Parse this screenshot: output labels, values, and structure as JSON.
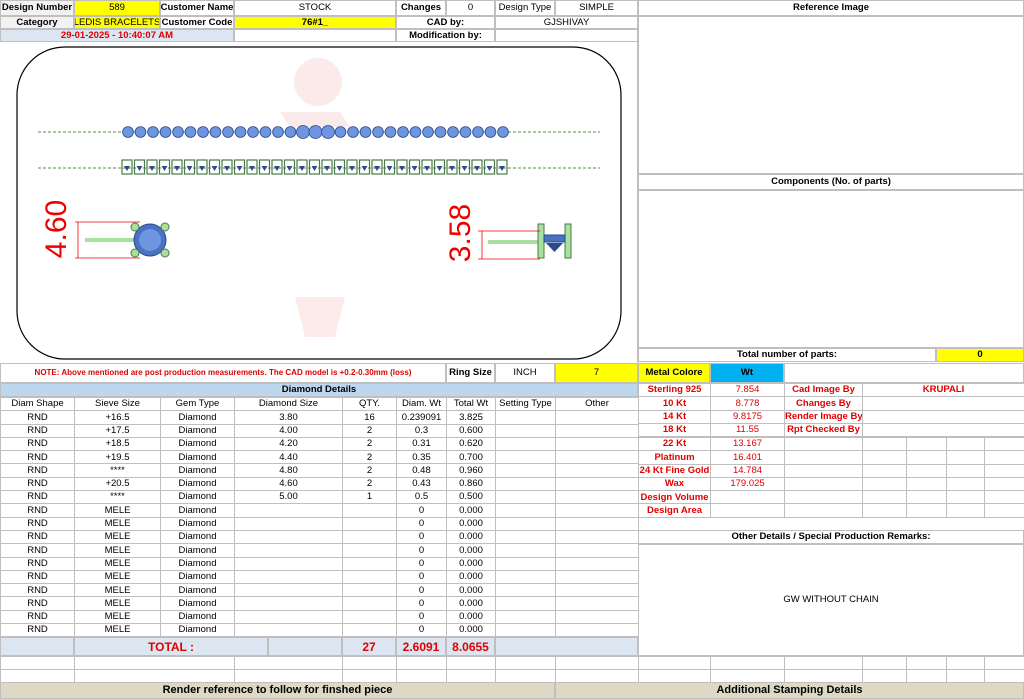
{
  "header": {
    "design_number_label": "Design Number",
    "design_number": "589",
    "customer_name_label": "Customer Name",
    "customer_name": "STOCK",
    "changes_label": "Changes",
    "changes": "0",
    "design_type_label": "Design Type",
    "design_type": "SIMPLE",
    "category_label": "Category",
    "category": "LEDIS BRACELETS",
    "customer_code_label": "Customer Code",
    "customer_code": "76#1_",
    "cad_by_label": "CAD by:",
    "cad_by": "GJSHIVAY",
    "datetime": "29-01-2025 - 10:40:07 AM",
    "modification_label": "Modification by:"
  },
  "drawing": {
    "dim_left": "4.60",
    "dim_right": "3.58"
  },
  "reference": {
    "reference_image_label": "Reference Image",
    "components_label": "Components (No. of parts)",
    "total_parts_label": "Total number of parts:",
    "total_parts": "0"
  },
  "note": {
    "text": "NOTE: Above mentioned are post production measurements. The CAD model is +0.2-0.30mm (loss)",
    "ring_size_label": "Ring Size",
    "ring_size_unit": "INCH",
    "ring_size": "7"
  },
  "diamond": {
    "title": "Diamond Details",
    "headers": [
      "Diam Shape",
      "Sieve Size",
      "Gem Type",
      "Diamond Size",
      "QTY.",
      "Diam. Wt",
      "Total Wt",
      "Setting Type",
      "Other"
    ],
    "rows": [
      [
        "RND",
        "+16.5",
        "Diamond",
        "3.80",
        "16",
        "0.239091",
        "3.825",
        "",
        ""
      ],
      [
        "RND",
        "+17.5",
        "Diamond",
        "4.00",
        "2",
        "0.3",
        "0.600",
        "",
        ""
      ],
      [
        "RND",
        "+18.5",
        "Diamond",
        "4.20",
        "2",
        "0.31",
        "0.620",
        "",
        ""
      ],
      [
        "RND",
        "+19.5",
        "Diamond",
        "4.40",
        "2",
        "0.35",
        "0.700",
        "",
        ""
      ],
      [
        "RND",
        "****",
        "Diamond",
        "4.80",
        "2",
        "0.48",
        "0.960",
        "",
        ""
      ],
      [
        "RND",
        "+20.5",
        "Diamond",
        "4.60",
        "2",
        "0.43",
        "0.860",
        "",
        ""
      ],
      [
        "RND",
        "****",
        "Diamond",
        "5.00",
        "1",
        "0.5",
        "0.500",
        "",
        ""
      ],
      [
        "RND",
        "MELE",
        "Diamond",
        "",
        "",
        "0",
        "0.000",
        "",
        ""
      ],
      [
        "RND",
        "MELE",
        "Diamond",
        "",
        "",
        "0",
        "0.000",
        "",
        ""
      ],
      [
        "RND",
        "MELE",
        "Diamond",
        "",
        "",
        "0",
        "0.000",
        "",
        ""
      ],
      [
        "RND",
        "MELE",
        "Diamond",
        "",
        "",
        "0",
        "0.000",
        "",
        ""
      ],
      [
        "RND",
        "MELE",
        "Diamond",
        "",
        "",
        "0",
        "0.000",
        "",
        ""
      ],
      [
        "RND",
        "MELE",
        "Diamond",
        "",
        "",
        "0",
        "0.000",
        "",
        ""
      ],
      [
        "RND",
        "MELE",
        "Diamond",
        "",
        "",
        "0",
        "0.000",
        "",
        ""
      ],
      [
        "RND",
        "MELE",
        "Diamond",
        "",
        "",
        "0",
        "0.000",
        "",
        ""
      ],
      [
        "RND",
        "MELE",
        "Diamond",
        "",
        "",
        "0",
        "0.000",
        "",
        ""
      ],
      [
        "RND",
        "MELE",
        "Diamond",
        "",
        "",
        "0",
        "0.000",
        "",
        ""
      ]
    ],
    "total_label": "TOTAL :",
    "total_qty": "27",
    "total_diam_wt": "2.6091",
    "total_wt": "8.0655"
  },
  "metal": {
    "color_label": "Metal Colore",
    "wt_label": "Wt",
    "rows": [
      {
        "name": "Sterling 925",
        "wt": "7.854",
        "right_label": "Cad Image By",
        "right_value": "KRUPALI"
      },
      {
        "name": "10 Kt",
        "wt": "8.778",
        "right_label": "Changes By",
        "right_value": ""
      },
      {
        "name": "14 Kt",
        "wt": "9.8175",
        "right_label": "Render Image By",
        "right_value": ""
      },
      {
        "name": "18 Kt",
        "wt": "11.55",
        "right_label": "Rpt Checked By",
        "right_value": ""
      },
      {
        "name": "22 Kt",
        "wt": "13.167",
        "right_label": "",
        "right_value": ""
      },
      {
        "name": "Platinum",
        "wt": "16.401",
        "right_label": "",
        "right_value": ""
      },
      {
        "name": "24 Kt Fine Gold",
        "wt": "14.784",
        "right_label": "",
        "right_value": ""
      },
      {
        "name": "Wax",
        "wt": "179.025",
        "right_label": "",
        "right_value": ""
      },
      {
        "name": "Design Volume",
        "wt": "",
        "right_label": "",
        "right_value": ""
      },
      {
        "name": "Design Area",
        "wt": "",
        "right_label": "",
        "right_value": ""
      }
    ]
  },
  "remarks": {
    "title": "Other Details / Special Production Remarks:",
    "text": "GW WITHOUT CHAIN"
  },
  "footer": {
    "left": "Render reference to follow for finshed piece",
    "right": "Additional Stamping Details"
  },
  "colors": {
    "yellow": "#ffff00",
    "header_blue": "#bdd7ee",
    "light_blue": "#dce6f1",
    "red_text": "#e00000",
    "cyan": "#00b0f0",
    "footer_tan": "#ddd9c4"
  }
}
